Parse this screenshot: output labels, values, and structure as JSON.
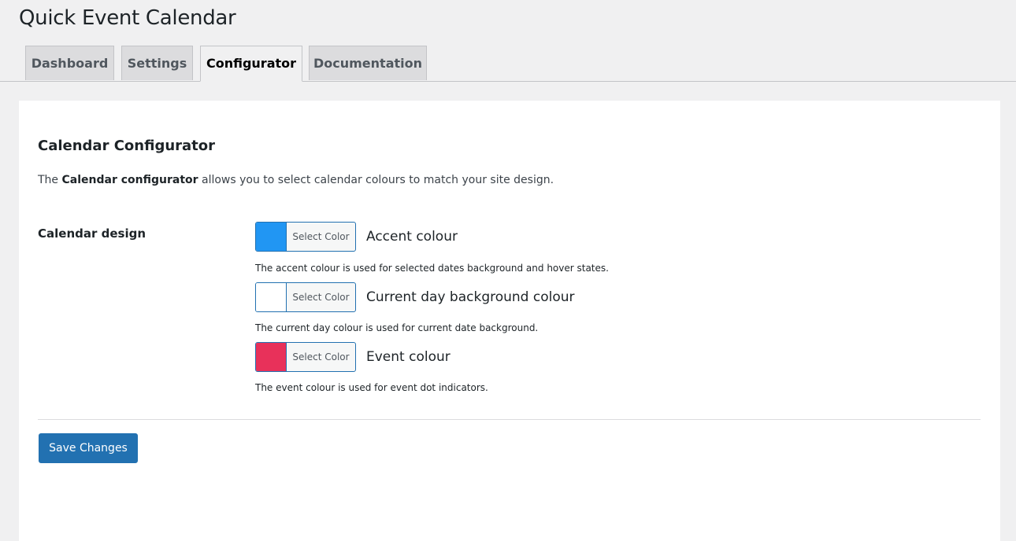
{
  "page_title": "Quick Event Calendar",
  "tabs": [
    {
      "label": "Dashboard",
      "active": false
    },
    {
      "label": "Settings",
      "active": false
    },
    {
      "label": "Configurator",
      "active": true
    },
    {
      "label": "Documentation",
      "active": false
    }
  ],
  "section": {
    "title": "Calendar Configurator",
    "intro_prefix": "The ",
    "intro_bold": "Calendar configurator",
    "intro_suffix": " allows you to select calendar colours to match your site design."
  },
  "design": {
    "label": "Calendar design",
    "colors": [
      {
        "button_label": "Select Color",
        "name": "Accent colour",
        "description": "The accent colour is used for selected dates background and hover states.",
        "value": "#2196f3"
      },
      {
        "button_label": "Select Color",
        "name": "Current day background colour",
        "description": "The current day colour is used for current date background.",
        "value": "#ffffff"
      },
      {
        "button_label": "Select Color",
        "name": "Event colour",
        "description": "The event colour is used for event dot indicators.",
        "value": "#e8315a"
      }
    ]
  },
  "save_button": "Save Changes",
  "colors": {
    "primary": "#2271b1",
    "background": "#f0f0f1"
  }
}
